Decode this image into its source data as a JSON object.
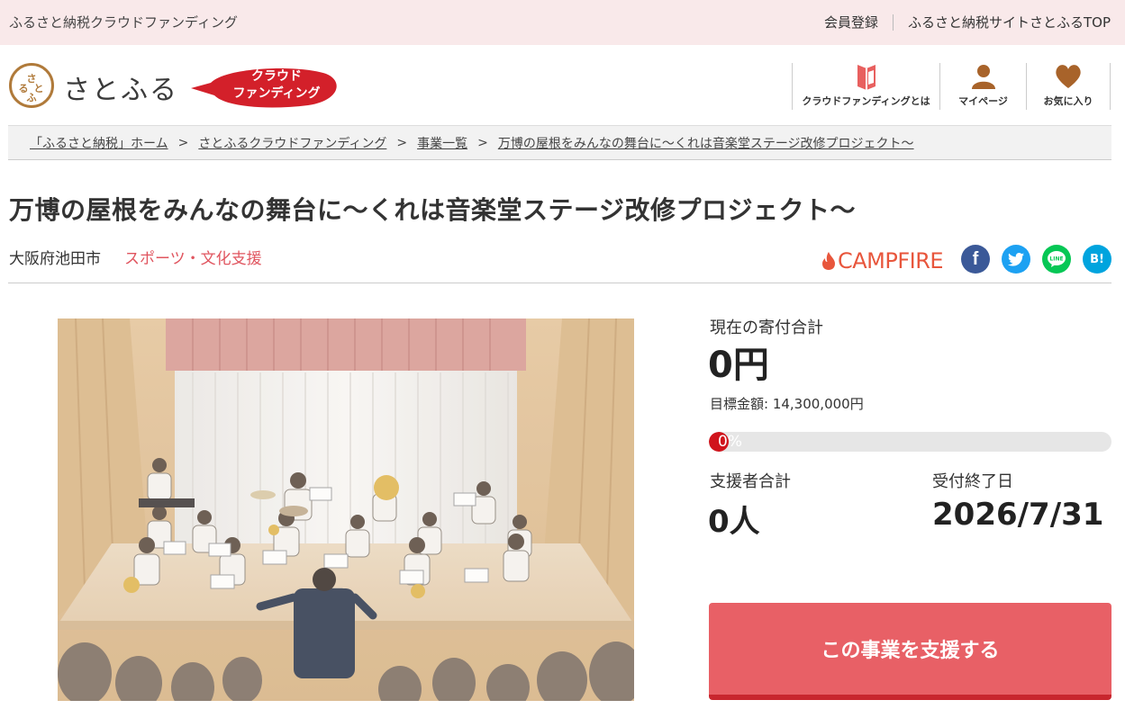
{
  "topbar": {
    "site_name": "ふるさと納税クラウドファンディング",
    "register": "会員登録",
    "satofull_top": "ふるさと納税サイトさとふるTOP"
  },
  "header": {
    "logo_mark": "さとふる",
    "logo_text": "さとふる",
    "badge_line1": "クラウド",
    "badge_line2": "ファンディング",
    "nav": [
      {
        "label": "クラウドファンディングとは",
        "icon": "book-icon"
      },
      {
        "label": "マイページ",
        "icon": "user-icon"
      },
      {
        "label": "お気に入り",
        "icon": "heart-icon"
      }
    ]
  },
  "breadcrumb": {
    "items": [
      "「ふるさと納税」ホーム",
      "さとふるクラウドファンディング",
      "事業一覧",
      "万博の屋根をみんなの舞台に～くれは音楽堂ステージ改修プロジェクト～"
    ],
    "separator": ">"
  },
  "project": {
    "title": "万博の屋根をみんなの舞台に～くれは音楽堂ステージ改修プロジェクト～",
    "city": "大阪府池田市",
    "category": "スポーツ・文化支援",
    "partner": "CAMPFIRE"
  },
  "share": {
    "facebook": "f",
    "line": "LINE",
    "hatena": "B!"
  },
  "stats": {
    "total_label": "現在の寄付合計",
    "total_value": "0円",
    "goal_text": "目標金額: 14,300,000円",
    "progress_text": "0%",
    "progress_fraction": 0,
    "supporters_label": "支援者合計",
    "supporters_value": "0人",
    "deadline_label": "受付終了日",
    "deadline_value": "2026/7/31"
  },
  "cta": {
    "label": "この事業を支援する"
  },
  "colors": {
    "accent": "#e86066",
    "category": "#e0555f",
    "topbar_bg": "#f9e9ea",
    "progress": "#d0141c"
  }
}
